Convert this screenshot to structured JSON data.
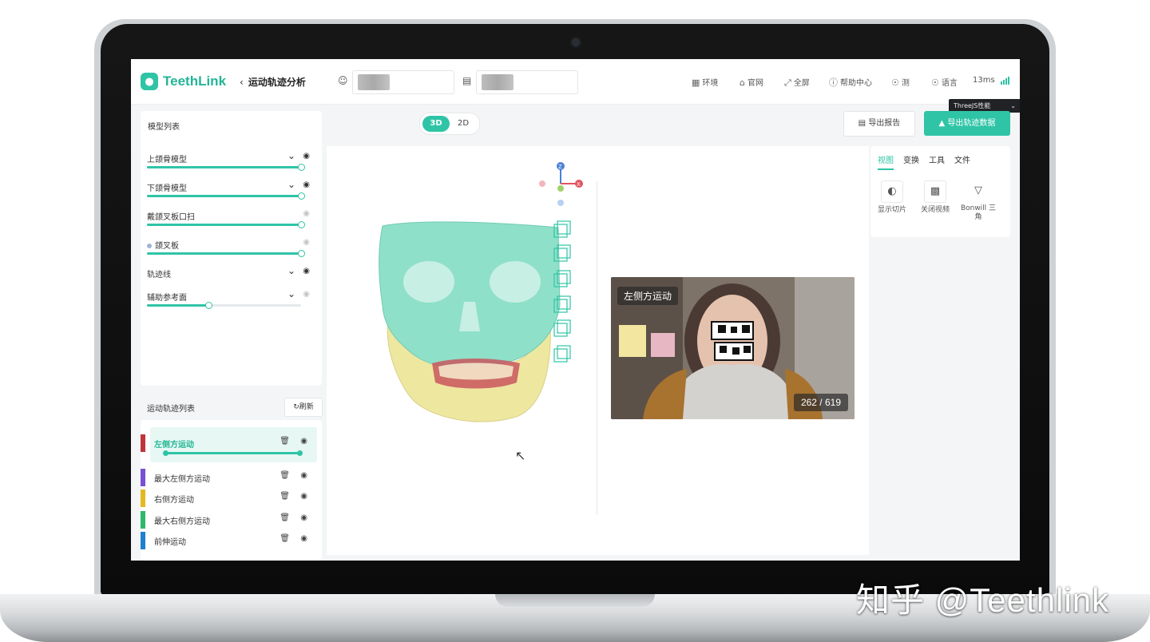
{
  "app": {
    "logo_text": "TeethLink",
    "page_title": "运动轨迹分析"
  },
  "nav": {
    "env": "环境",
    "site": "官网",
    "fullscreen": "全屏",
    "help": "帮助中心",
    "user": "测",
    "language": "语言",
    "latency": "13ms"
  },
  "perf_dropdown": "ThreeJS性能",
  "view_toggle": {
    "a": "3D",
    "b": "2D",
    "active": "3D"
  },
  "buttons": {
    "report": "导出报告",
    "export": "导出轨迹数据"
  },
  "model_list": {
    "title": "模型列表",
    "items": [
      {
        "label": "上颌骨模型",
        "visible": true,
        "level": 1.0,
        "expand": true
      },
      {
        "label": "下颌骨模型",
        "visible": true,
        "level": 1.0,
        "expand": true
      },
      {
        "label": "戴颌叉板口扫",
        "visible": false,
        "level": 1.0,
        "expand": false
      },
      {
        "label": "颌叉板",
        "visible": false,
        "level": 1.0,
        "expand": false,
        "dot": true
      },
      {
        "label": "轨迹线",
        "visible": true,
        "expand": true
      },
      {
        "label": "辅助参考面",
        "visible": false,
        "level": 0.4,
        "expand": true
      }
    ]
  },
  "trajectory_list": {
    "title": "运动轨迹列表",
    "refresh": "刷新",
    "items": [
      {
        "label": "左侧方运动",
        "color": "#c0343b",
        "active": true
      },
      {
        "label": "最大左侧方运动",
        "color": "#7a4fd6"
      },
      {
        "label": "右侧方运动",
        "color": "#e5b820"
      },
      {
        "label": "最大右侧方运动",
        "color": "#2fb86a"
      },
      {
        "label": "前伸运动",
        "color": "#1f7fd0"
      }
    ]
  },
  "video": {
    "label": "左侧方运动",
    "frame": "262 / 619"
  },
  "right_panel": {
    "tabs": [
      "视图",
      "变换",
      "工具",
      "文件"
    ],
    "tools": [
      {
        "label": "显示切片",
        "icon": "slice-icon"
      },
      {
        "label": "关闭视频",
        "icon": "video-off-icon"
      },
      {
        "label": "Bonwill 三角",
        "icon": "triangle-icon"
      }
    ]
  },
  "axis_labels": {
    "z": "Z",
    "x": "X"
  },
  "watermark": "知乎 @Teethlink",
  "colors": {
    "accent": "#2fc4a6",
    "maxilla": "#8fe0c8",
    "mandible": "#efe8a2"
  }
}
